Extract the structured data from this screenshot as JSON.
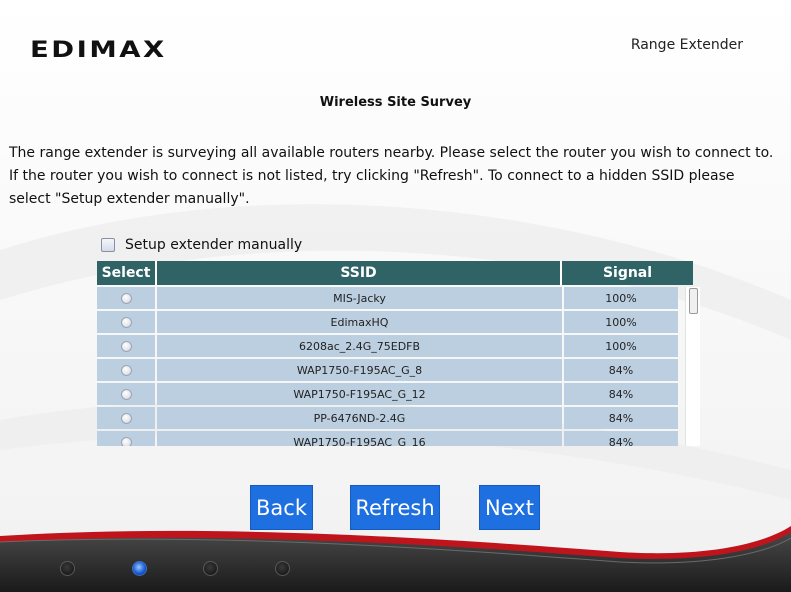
{
  "header": {
    "logo": "EDIMAX",
    "product": "Range Extender"
  },
  "page": {
    "title": "Wireless Site Survey",
    "intro": "The range extender is surveying all available routers nearby. Please select the router you wish to connect to. If the router you wish to connect is not listed, try clicking \"Refresh\". To connect to a hidden SSID please select \"Setup extender manually\"."
  },
  "manual": {
    "label": "Setup extender manually",
    "checked": false
  },
  "table": {
    "headers": {
      "select": "Select",
      "ssid": "SSID",
      "signal": "Signal"
    },
    "rows": [
      {
        "ssid": "MIS-Jacky",
        "signal": "100%"
      },
      {
        "ssid": "EdimaxHQ",
        "signal": "100%"
      },
      {
        "ssid": "6208ac_2.4G_75EDFB",
        "signal": "100%"
      },
      {
        "ssid": "WAP1750-F195AC_G_8",
        "signal": "84%"
      },
      {
        "ssid": "WAP1750-F195AC_G_12",
        "signal": "84%"
      },
      {
        "ssid": "PP-6476ND-2.4G",
        "signal": "84%"
      },
      {
        "ssid": "WAP1750-F195AC_G_16",
        "signal": "84%"
      }
    ]
  },
  "buttons": {
    "back": "Back",
    "refresh": "Refresh",
    "next": "Next"
  },
  "footer": {
    "steps": 4,
    "active_step": 2
  },
  "colors": {
    "accent": "#1e6fe0",
    "table_header": "#2f6366",
    "row_bg": "#bccfe0",
    "footer_stripe": "#c0141c"
  }
}
